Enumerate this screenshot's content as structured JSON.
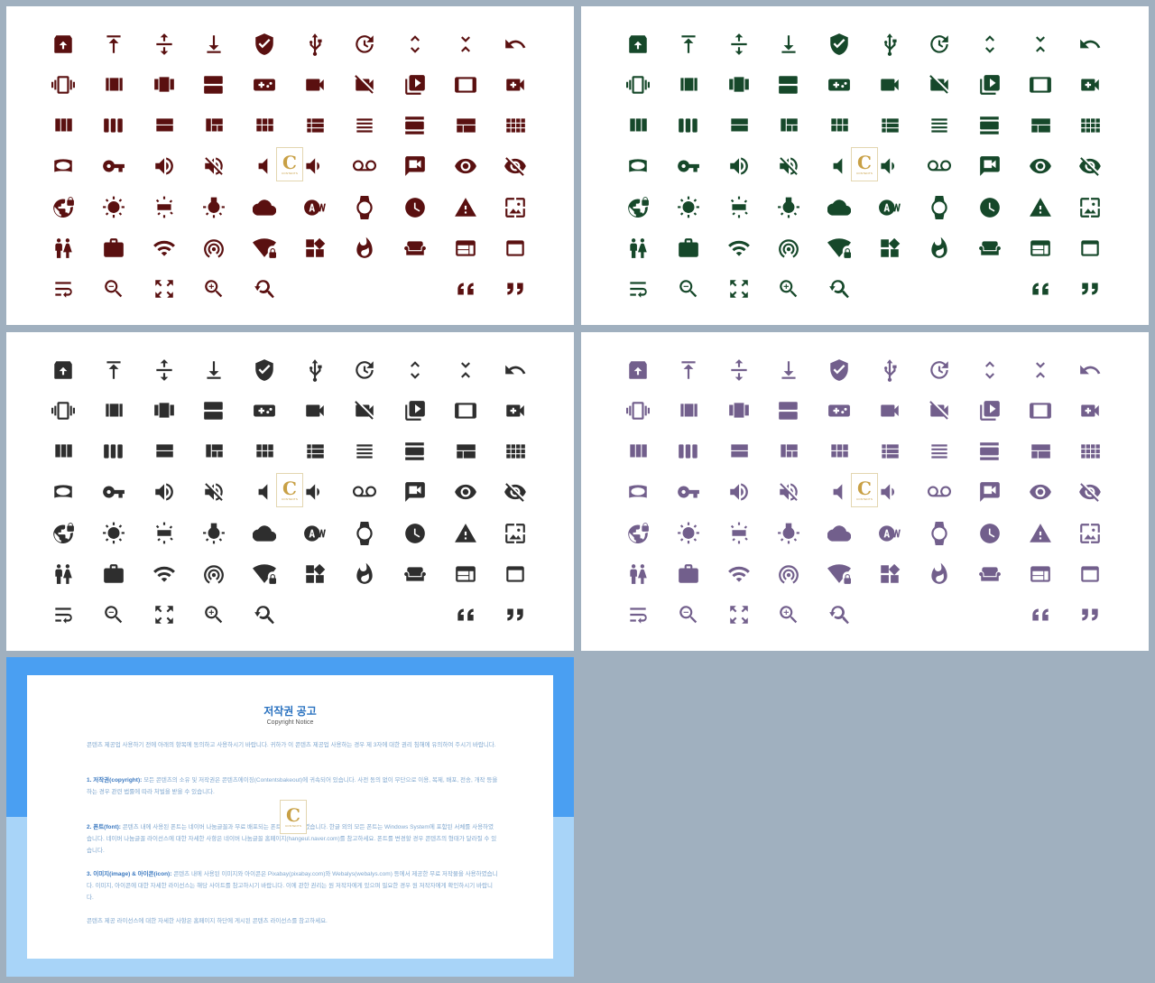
{
  "icon_sets": [
    {
      "name": "brown-set",
      "color": "#5a1010"
    },
    {
      "name": "green-set",
      "color": "#16482a"
    },
    {
      "name": "dark-set",
      "color": "#2e2e2e"
    },
    {
      "name": "purple-set",
      "color": "#725f8c"
    }
  ],
  "icon_rows": [
    [
      "unarchive-icon",
      "vertical-align-top-icon",
      "vertical-align-center-icon",
      "vertical-align-bottom-icon",
      "verified-user-icon",
      "usb-icon",
      "update-icon",
      "unfold-more-icon",
      "unfold-less-icon",
      "undo-icon"
    ],
    [
      "vibration-icon",
      "view-array-icon",
      "view-carousel-icon",
      "view-agenda-icon",
      "videogame-icon",
      "videocam-icon",
      "videocam-off-icon",
      "video-library-icon",
      "tablet-icon",
      "video-call-icon"
    ],
    [
      "view-column-icon",
      "view-week-icon",
      "view-stream-icon",
      "view-quilt-icon",
      "view-module-icon",
      "view-list-icon",
      "view-headline-icon",
      "view-day-icon",
      "view-compact-icon",
      "view-comfy-icon"
    ],
    [
      "panorama-wide-icon",
      "vpn-key-icon",
      "volume-up-icon",
      "volume-off-icon",
      "volume-mute-icon",
      "",
      "volume-down-icon",
      "voicemail-icon",
      "voice-chat-icon",
      "visibility-icon",
      "visibility-off-icon"
    ],
    [
      "vpn-lock-icon",
      "brightness-icon",
      "wb-iridescent-icon",
      "wb-incandescent-icon",
      "cloud-icon",
      "auto-white-balance-icon",
      "watch-icon",
      "clock-icon",
      "warning-icon",
      "wallpaper-icon"
    ],
    [
      "wc-icon",
      "work-icon",
      "wifi-icon",
      "wifi-tethering-icon",
      "wifi-lock-icon",
      "widgets-icon",
      "whatshot-icon",
      "weekend-icon",
      "web-icon",
      "web-asset-icon"
    ],
    [
      "wrap-text-icon",
      "zoom-out-icon",
      "zoom-out-map-icon",
      "zoom-in-icon",
      "youtube-searched-for-icon",
      "",
      "",
      "",
      "format-quote-open-icon",
      "format-quote-close-icon"
    ]
  ],
  "watermark": {
    "letter": "C",
    "text": "CONTENTS"
  },
  "notice": {
    "title": "저작권 공고",
    "subtitle": "Copyright Notice",
    "p1": "콘텐츠 제공업 사용하기 전에 아래의 항목에 동의하고 사용하시기 바랍니다. 귀하가 이 콘텐츠 제공업 사용하는 경우 제 3자에 대한 권리 침해에 유의하여 주시기 바랍니다.",
    "p2_head": "1. 저작권(copyright):",
    "p2": "모든 콘텐츠의 소유 및 저작권은 콘텐츠에이징(Contentsbakeout)에 귀속되어 있습니다. 사전 동의 없이 무단으로 이용, 복제, 배포, 전송, 개작 등을 하는 경우 관련 법률에 따라 처벌을 받을 수 있습니다.",
    "p3_head": "2. 폰트(font):",
    "p3": "콘텐츠 내에 사용된 폰트는 네이버 나눔글꼴과 무료 배포되는 폰트를 사용하였습니다. 한글 외의 모든 폰트는 Windows System에 포함된 서체를 사용하였습니다. 네이버 나눔글꼴 라이선스에 대한 자세한 사항은 네이버 나눔글꼴 홈페이지(hangeul.naver.com)를 참고하세요. 폰트를 변경할 경우 콘텐츠의 형태가 달라질 수 있습니다.",
    "p4_head": "3. 이미지(image) & 아이콘(icon):",
    "p4": "콘텐츠 내에 사용된 이미지와 아이콘은 Pixabay(pixabay.com)와 Webalys(webalys.com) 등에서 제공한 무료 저작물을 사용하였습니다. 이미지, 아이콘에 대한 자세한 라이선스는 해당 사이트를 참고하시기 바랍니다. 이에 관한 권리는 원 저작자에게 있으며 필요한 경우 원 저작자에게 확인하시기 바랍니다.",
    "p5": "콘텐츠 제공 라이선스에 대한 자세한 사항은 홈페이지 하단에 게시된 콘텐츠 라이선스를 참고하세요."
  }
}
